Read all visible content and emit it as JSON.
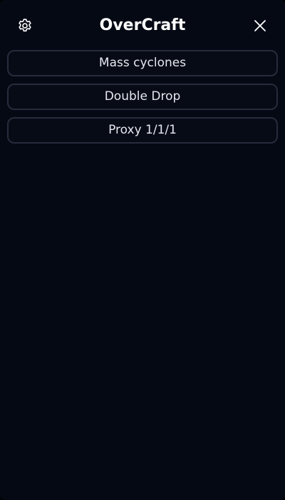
{
  "header": {
    "title": "OverCraft",
    "settings_icon": "gear-icon",
    "close_icon": "close-icon"
  },
  "builds": [
    {
      "label": "Mass cyclones"
    },
    {
      "label": "Double Drop"
    },
    {
      "label": "Proxy 1/1/1"
    }
  ],
  "colors": {
    "background": "#050914",
    "item_border": "#262c3c",
    "text": "#e6e8ee",
    "title": "#ffffff"
  }
}
